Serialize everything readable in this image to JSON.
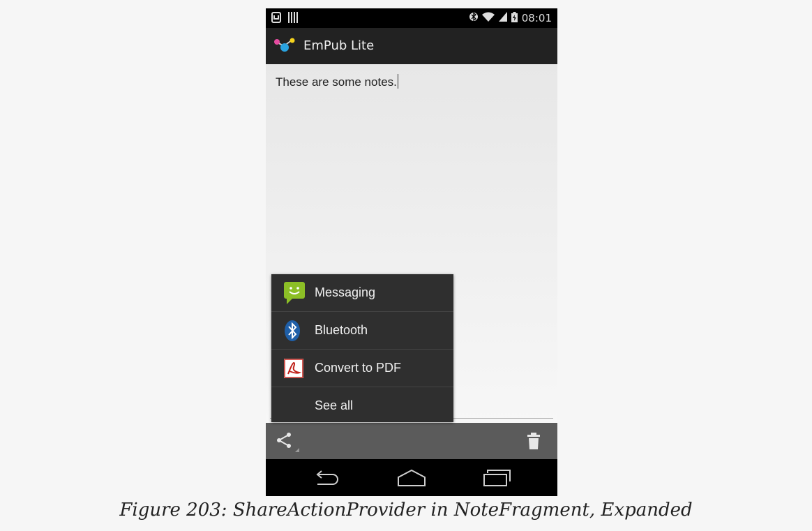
{
  "statusbar": {
    "time": "08:01",
    "icons": [
      "usb-debug-icon",
      "barcode-icon",
      "bluetooth-icon",
      "wifi-icon",
      "signal-icon",
      "battery-icon"
    ]
  },
  "actionbar": {
    "title": "EmPub Lite",
    "icon": "app-logo-icon"
  },
  "content": {
    "note_text": "These are some notes."
  },
  "share_popup": {
    "items": [
      {
        "label": "Messaging",
        "icon": "messaging-icon",
        "color": "#8cbf26"
      },
      {
        "label": "Bluetooth",
        "icon": "bluetooth-icon",
        "color": "#1f5fa8"
      },
      {
        "label": "Convert to PDF",
        "icon": "pdf-icon",
        "color": "#c0221b"
      },
      {
        "label": "See all",
        "icon": ""
      }
    ]
  },
  "bottombar": {
    "share_icon": "share-icon",
    "delete_icon": "trash-icon"
  },
  "navbar": {
    "buttons": [
      "back-icon",
      "home-icon",
      "recents-icon"
    ]
  },
  "caption": "Figure 203: ShareActionProvider in NoteFragment, Expanded"
}
